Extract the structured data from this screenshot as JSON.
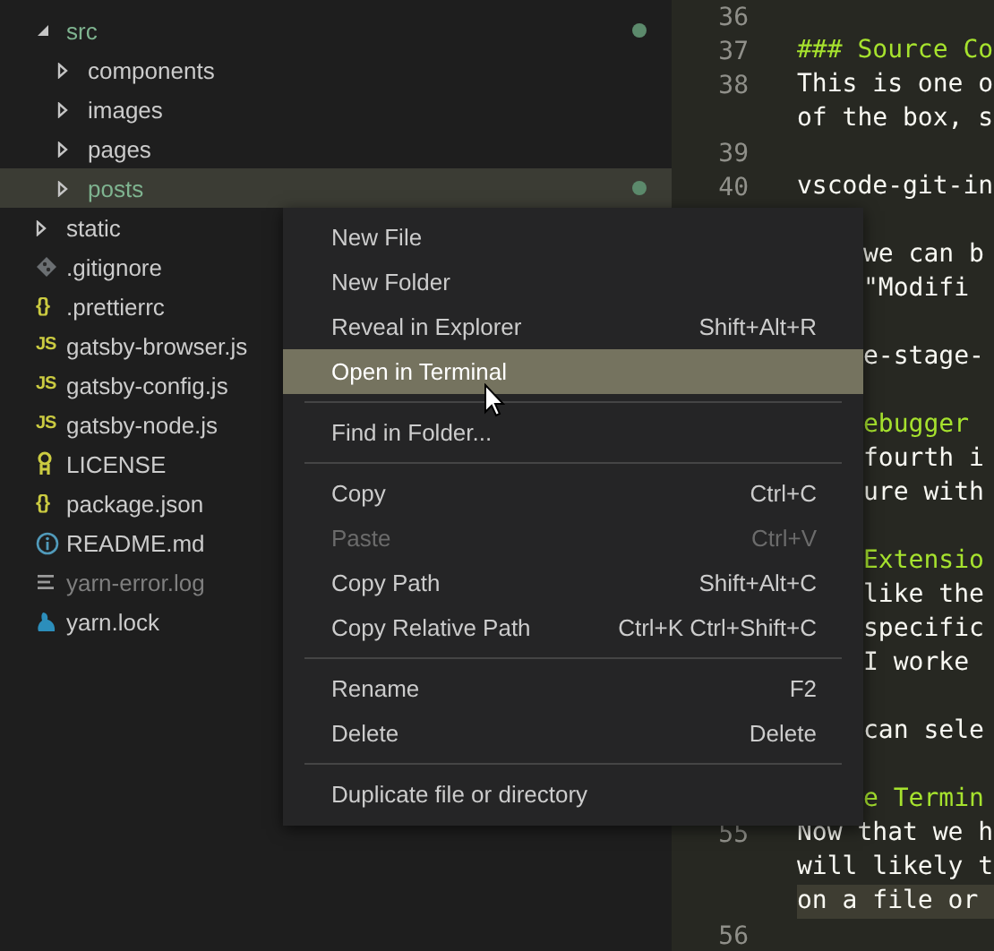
{
  "tree": [
    {
      "name": "src",
      "kind": "folder",
      "expanded": true,
      "selected": false,
      "modified": true,
      "dimmed": false,
      "children": [
        {
          "name": "components",
          "kind": "folder",
          "expanded": false,
          "selected": false,
          "modified": false,
          "dimmed": false
        },
        {
          "name": "images",
          "kind": "folder",
          "expanded": false,
          "selected": false,
          "modified": false,
          "dimmed": false
        },
        {
          "name": "pages",
          "kind": "folder",
          "expanded": false,
          "selected": false,
          "modified": false,
          "dimmed": false
        },
        {
          "name": "posts",
          "kind": "folder",
          "expanded": false,
          "selected": true,
          "modified": true,
          "dimmed": false
        }
      ]
    },
    {
      "name": "static",
      "kind": "folder",
      "expanded": false,
      "selected": false,
      "modified": false,
      "dimmed": false
    },
    {
      "name": ".gitignore",
      "kind": "git",
      "selected": false,
      "modified": false,
      "dimmed": false
    },
    {
      "name": ".prettierrc",
      "kind": "json",
      "icon_text": "{}",
      "selected": false,
      "modified": false,
      "dimmed": false
    },
    {
      "name": "gatsby-browser.js",
      "kind": "js",
      "icon_text": "JS",
      "selected": false,
      "modified": false,
      "dimmed": false
    },
    {
      "name": "gatsby-config.js",
      "kind": "js",
      "icon_text": "JS",
      "selected": false,
      "modified": false,
      "dimmed": false
    },
    {
      "name": "gatsby-node.js",
      "kind": "js",
      "icon_text": "JS",
      "selected": false,
      "modified": false,
      "dimmed": false
    },
    {
      "name": "LICENSE",
      "kind": "license",
      "selected": false,
      "modified": false,
      "dimmed": false
    },
    {
      "name": "package.json",
      "kind": "json",
      "icon_text": "{}",
      "selected": false,
      "modified": false,
      "dimmed": false
    },
    {
      "name": "README.md",
      "kind": "readme",
      "selected": false,
      "modified": false,
      "dimmed": false
    },
    {
      "name": "yarn-error.log",
      "kind": "log",
      "selected": false,
      "modified": false,
      "dimmed": true
    },
    {
      "name": "yarn.lock",
      "kind": "yarn",
      "selected": false,
      "modified": false,
      "dimmed": false
    }
  ],
  "editor": {
    "lines": [
      {
        "number": "36",
        "kind": "text",
        "current": false
      },
      {
        "number": "37",
        "text": "### Source Co",
        "kind": "heading",
        "covered": false,
        "current": false
      },
      {
        "number": "38",
        "text": "This is one o",
        "kind": "text",
        "covered": false,
        "current": false
      },
      {
        "text": "of the box, s",
        "kind": "text",
        "covered": false,
        "current": false
      },
      {
        "number": "39",
        "kind": "text",
        "current": false
      },
      {
        "number": "40",
        "text": "vscode-git-in",
        "kind": "text",
        "covered": false,
        "current": false
      },
      {
        "kind": "text",
        "current": false
      },
      {
        "text": "we can b",
        "kind": "text",
        "covered": true,
        "current": false
      },
      {
        "text": "\"Modifi",
        "kind": "text",
        "covered": true,
        "current": false
      },
      {
        "kind": "text",
        "current": false
      },
      {
        "text": "e-stage-",
        "kind": "text",
        "covered": true,
        "current": false
      },
      {
        "kind": "text",
        "current": false
      },
      {
        "text": "ebugger",
        "kind": "heading",
        "covered": true,
        "current": false
      },
      {
        "text": "fourth i",
        "kind": "text",
        "covered": true,
        "current": false
      },
      {
        "text": "ure with",
        "kind": "text",
        "covered": true,
        "current": false
      },
      {
        "kind": "text",
        "current": false
      },
      {
        "text": "Extensio",
        "kind": "heading",
        "covered": true,
        "current": false
      },
      {
        "text": "like the",
        "kind": "text",
        "covered": true,
        "current": false
      },
      {
        "text": "specific",
        "kind": "text",
        "covered": true,
        "current": false
      },
      {
        "text": "I worke",
        "kind": "text",
        "covered": true,
        "current": false
      },
      {
        "kind": "text",
        "current": false
      },
      {
        "text": "can sele",
        "kind": "text",
        "covered": true,
        "current": false
      },
      {
        "kind": "text",
        "current": false
      },
      {
        "text": "e Termin",
        "kind": "heading",
        "covered": true,
        "current": false
      },
      {
        "number": "55",
        "text": "Now that we h",
        "kind": "text",
        "covered": false,
        "current": false
      },
      {
        "text": "will likely t",
        "kind": "text",
        "covered": false,
        "current": false
      },
      {
        "text": "on a file or",
        "kind": "text",
        "covered": false,
        "current": true
      },
      {
        "number": "56",
        "kind": "text",
        "current": false
      }
    ]
  },
  "context_menu": {
    "items": [
      {
        "kind": "item",
        "label": "New File",
        "selected": false,
        "disabled": false
      },
      {
        "kind": "item",
        "label": "New Folder",
        "selected": false,
        "disabled": false
      },
      {
        "kind": "item",
        "label": "Reveal in Explorer",
        "shortcut": "Shift+Alt+R",
        "selected": false,
        "disabled": false
      },
      {
        "kind": "item",
        "label": "Open in Terminal",
        "selected": true,
        "disabled": false
      },
      {
        "kind": "separator"
      },
      {
        "kind": "item",
        "label": "Find in Folder...",
        "selected": false,
        "disabled": false
      },
      {
        "kind": "separator"
      },
      {
        "kind": "item",
        "label": "Copy",
        "shortcut": "Ctrl+C",
        "selected": false,
        "disabled": false
      },
      {
        "kind": "item",
        "label": "Paste",
        "shortcut": "Ctrl+V",
        "selected": false,
        "disabled": true
      },
      {
        "kind": "item",
        "label": "Copy Path",
        "shortcut": "Shift+Alt+C",
        "selected": false,
        "disabled": false
      },
      {
        "kind": "item",
        "label": "Copy Relative Path",
        "shortcut": "Ctrl+K Ctrl+Shift+C",
        "selected": false,
        "disabled": false
      },
      {
        "kind": "separator"
      },
      {
        "kind": "item",
        "label": "Rename",
        "shortcut": "F2",
        "selected": false,
        "disabled": false
      },
      {
        "kind": "item",
        "label": "Delete",
        "shortcut": "Delete",
        "selected": false,
        "disabled": false
      },
      {
        "kind": "separator"
      },
      {
        "kind": "item",
        "label": "Duplicate file or directory",
        "selected": false,
        "disabled": false
      }
    ]
  }
}
